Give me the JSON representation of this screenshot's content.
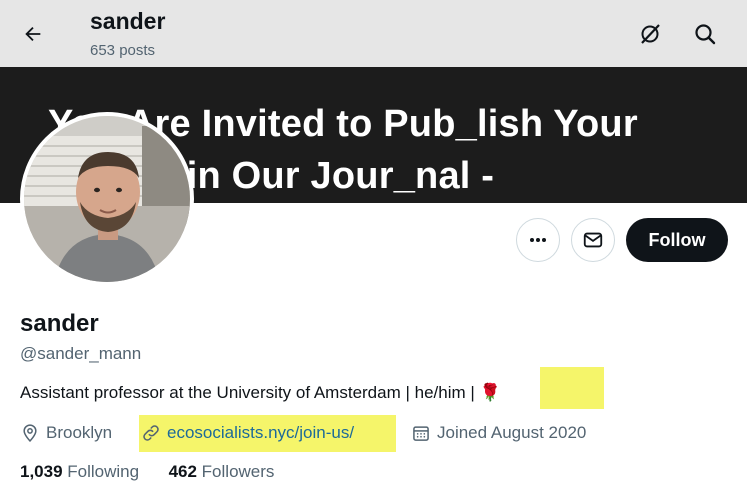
{
  "header": {
    "title": "sander",
    "post_count": "653 posts",
    "icons": [
      "back-arrow-icon",
      "grok-icon",
      "search-icon"
    ]
  },
  "banner": {
    "line1": "You Are Invited to Pub_lish Your",
    "line2": "Papers in Our Jour_nal -"
  },
  "actions": {
    "more_icon": "more-dots-icon",
    "message_icon": "envelope-icon",
    "follow_label": "Follow"
  },
  "profile": {
    "name": "sander",
    "handle": "@sander_mann",
    "bio": "Assistant professor at the University of Amsterdam | he/him |",
    "bio_emoji": "🌹",
    "location": "Brooklyn",
    "website": "ecosocialists.nyc/join-us/",
    "joined": "Joined August 2020",
    "following_count": "1,039",
    "following_label": "Following",
    "followers_count": "462",
    "followers_label": "Followers"
  },
  "colors": {
    "highlight": "#f5f56a",
    "link": "#1d6a99",
    "banner_bg": "#1c1c1c",
    "follow_bg": "#0f1419"
  }
}
